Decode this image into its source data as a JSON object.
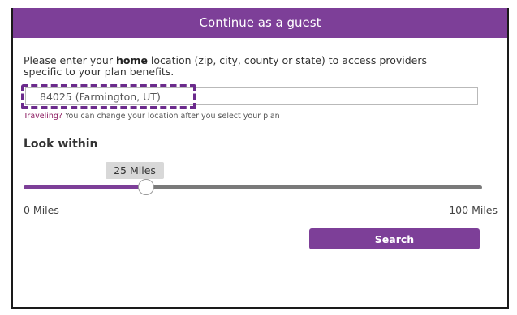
{
  "header": {
    "title": "Continue as a guest"
  },
  "intro": {
    "text_before": "Please enter your ",
    "bold_word": "home",
    "text_after": " location (zip, city, county or state) to access providers specific to your plan benefits."
  },
  "location_input": {
    "value": "84025 (Farmington, UT)"
  },
  "hint": {
    "traveling": "Traveling?",
    "rest": " You can change your location after you select your plan"
  },
  "distance": {
    "heading": "Look within",
    "value_label": "25 Miles",
    "value": 25,
    "min": 0,
    "max": 100,
    "min_label": "0 Miles",
    "max_label": "100 Miles"
  },
  "search_button": {
    "label": "Search"
  },
  "colors": {
    "brand_purple": "#7d3f98",
    "highlight_dash": "#6b2a8c",
    "traveling_link": "#8b1a60"
  }
}
